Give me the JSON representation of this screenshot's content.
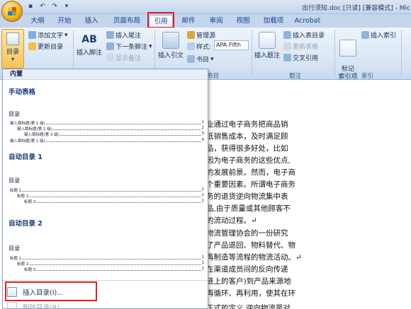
{
  "titlebar": {
    "title": "出行须知.doc [只读] [兼容模式] - Mic",
    "qat_icons": [
      "save-icon",
      "undo-icon",
      "redo-icon",
      "customize-icon"
    ]
  },
  "tabs": [
    {
      "label": "大纲"
    },
    {
      "label": "开始"
    },
    {
      "label": "插入"
    },
    {
      "label": "页面布局"
    },
    {
      "label": "引用"
    },
    {
      "label": "邮件"
    },
    {
      "label": "审阅"
    },
    {
      "label": "视图"
    },
    {
      "label": "加载项"
    },
    {
      "label": "Acrobat"
    }
  ],
  "ribbon": {
    "toc_button": "目录",
    "add_text": "添加文字",
    "update_toc": "更新目录",
    "insert_footnote": "插入脚注",
    "insert_endnote": "插入尾注",
    "next_footnote": "下一条脚注",
    "show_notes": "显示备注",
    "insert_citation": "插入引文",
    "manage_sources": "管理源",
    "style_label": "样式:",
    "style_value": "APA Fifth",
    "bibliography": "书目",
    "insert_caption": "插入题注",
    "insert_table_of_figures": "插入表目录",
    "update_table": "更新表格",
    "cross_reference": "交叉引用",
    "mark_entry": "标记\n索引项",
    "insert_index": "插入索引",
    "group_citations": "书目",
    "group_captions": "题注",
    "group_index": "索引",
    "ab_label": "AB"
  },
  "dropdown": {
    "header_builtin": "内置",
    "sections": [
      {
        "title": "手动表格",
        "toc_heading": "目录",
        "entries": [
          "键入章标题(第 1 级)",
          "键入章标题(第 2 级)",
          "键入章标题(第 3 级)",
          "键入章标题(第 1 级)"
        ],
        "pages": [
          "1",
          "2",
          "3",
          "4"
        ]
      },
      {
        "title": "自动目录 1",
        "toc_heading": "目录",
        "entries": [
          "标题 1",
          "标题 2",
          "标题 3"
        ],
        "pages": [
          "1",
          "1",
          "1"
        ]
      },
      {
        "title": "自动目录 2",
        "toc_heading": "目录",
        "entries": [
          "标题 1",
          "标题 2",
          "标题 3"
        ],
        "pages": [
          "1",
          "1",
          "1"
        ]
      }
    ],
    "insert_toc": "插入目录(I)...",
    "delete_toc": "删除目录(R)"
  },
  "document": {
    "lines": [
      "业通过电子商务把商品销",
      "低销售成本，及时满足顾",
      "品，获得很多好处，比如",
      "因为电子商务的这些优点,",
      "的发展前景。然而，电子商",
      "个重要因素。所谓电子商务",
      "务的退货逆向物流集中表",
      "品,由于质量或其他顾客不",
      "的流动过程。↵",
      "物流管理协会的一份研究",
      "了产品退回、物料替代、物",
      "再制造等流程的物流活动。↵",
      "在渠道成员间的反向传递",
      "链上的客户)到产品来源地",
      "再循环、再利用，使其在环",
      "正式的定义,逆向物流是对"
    ]
  }
}
